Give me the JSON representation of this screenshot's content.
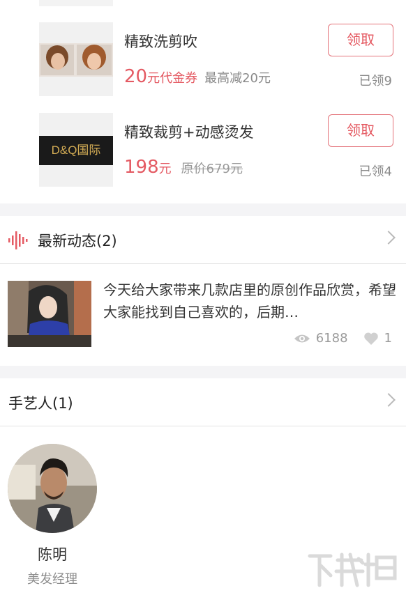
{
  "offers": [
    {
      "title": "精致洗剪吹",
      "price": "20",
      "price_unit": "元代金券",
      "note": "最高减20元",
      "claim_label": "领取",
      "claimed": "已领9"
    },
    {
      "title": "精致裁剪+动感烫发",
      "price": "198",
      "price_unit": "元",
      "original_price": "原价679元",
      "claim_label": "领取",
      "claimed": "已领4",
      "thumb_text": "D&Q国际"
    }
  ],
  "news": {
    "header": "最新动态(2)",
    "post_text": "今天给大家带来几款店里的原创作品欣赏，希望大家能找到自己喜欢的，后期…",
    "views": "6188",
    "likes": "1"
  },
  "artisans": {
    "header": "手艺人(1)",
    "name": "陈明",
    "role": "美发经理"
  },
  "colors": {
    "accent": "#e45a63",
    "background_gap": "#f4f4f6"
  }
}
